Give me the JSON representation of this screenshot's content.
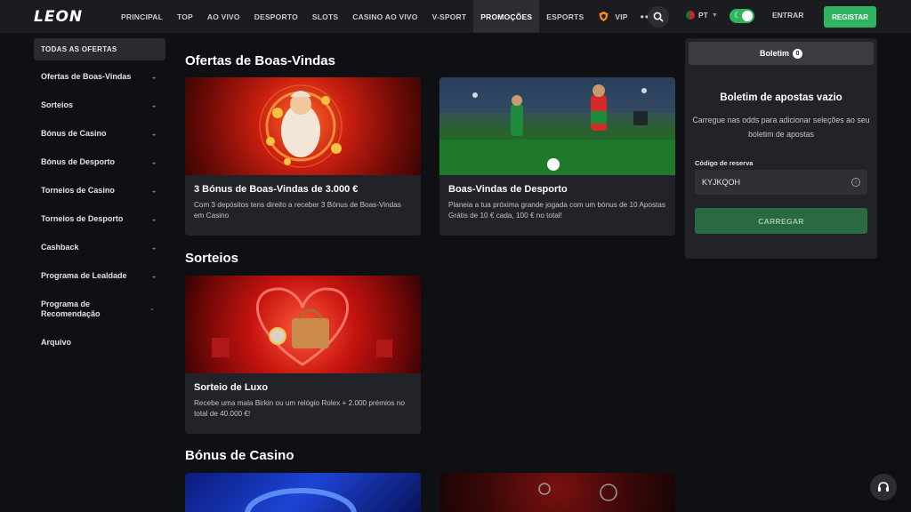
{
  "header": {
    "logo": "LEON",
    "nav": [
      "PRINCIPAL",
      "TOP",
      "AO VIVO",
      "DESPORTO",
      "SLOTS",
      "CASINO AO VIVO",
      "V-SPORT",
      "PROMOÇÕES",
      "ESPORTS",
      "VIP"
    ],
    "more_label": "•••",
    "active_nav": "PROMOÇÕES",
    "language": "PT",
    "login_label": "ENTRAR",
    "register_label": "REGISTAR"
  },
  "sidebar": {
    "all_offers": "TODAS AS OFERTAS",
    "items": [
      {
        "label": "Ofertas de Boas-Vindas"
      },
      {
        "label": "Sorteios"
      },
      {
        "label": "Bónus de Casino"
      },
      {
        "label": "Bónus de Desporto"
      },
      {
        "label": "Torneios de Casino"
      },
      {
        "label": "Torneios de Desporto"
      },
      {
        "label": "Cashback"
      },
      {
        "label": "Programa de Lealdade"
      },
      {
        "label": "Programa de Recomendação"
      },
      {
        "label": "Arquivo"
      }
    ]
  },
  "sections": [
    {
      "title": "Ofertas de Boas-Vindas",
      "cards": [
        {
          "title": "3 Bónus de Boas-Vindas de 3.000 €",
          "description": "Com 3 depósitos tens direito a receber 3 Bónus de Boas-Vindas em Casino"
        },
        {
          "title": "Boas-Vindas de Desporto",
          "description": "Planeia a tua próxima grande jogada com um bónus de 10 Apostas Grátis de 10 € cada, 100 € no total!"
        }
      ]
    },
    {
      "title": "Sorteios",
      "cards": [
        {
          "title": "Sorteio de Luxo",
          "description": "Recebe uma mala Birkin ou um relógio Rolex + 2.000 prémios no total de 40.000 €!"
        }
      ]
    },
    {
      "title": "Bónus de Casino",
      "cards": []
    }
  ],
  "betslip": {
    "tab_label": "Boletim",
    "count": "0",
    "empty_title": "Boletim de apostas vazio",
    "empty_desc": "Carregue nas odds para adicionar seleções ao seu boletim de apostas",
    "code_label": "Código de reserva",
    "code_value": "KYJKQOH",
    "load_label": "CARREGAR"
  },
  "colors": {
    "accent": "#2fb55f",
    "background": "#0f1013",
    "panel": "#222328"
  }
}
